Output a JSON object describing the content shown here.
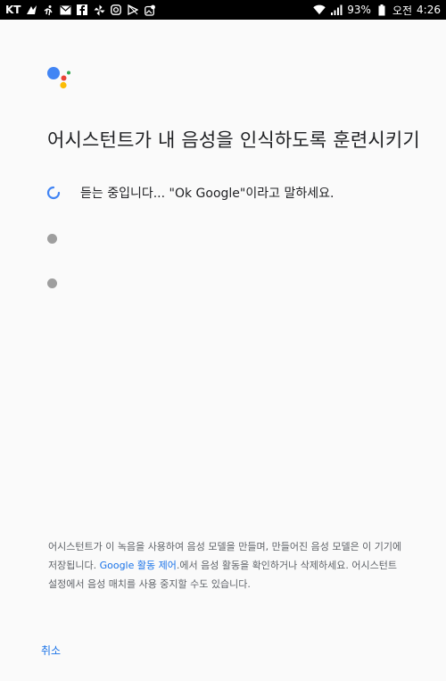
{
  "status_bar": {
    "carrier": "KT",
    "battery_percent": "93%",
    "time_period": "오전",
    "time": "4:26",
    "left_icons": [
      "vpn-key-icon",
      "activity-icon",
      "mail-icon",
      "facebook-icon",
      "pinwheel-icon",
      "instagram-icon",
      "play-icon",
      "gallery-icon"
    ],
    "right_icons": [
      "wifi-icon",
      "signal-icon",
      "battery-icon"
    ]
  },
  "assistant": {
    "logo_colors": {
      "blue": "#4285F4",
      "red": "#EA4335",
      "yellow": "#FBBC05",
      "green": "#34A853"
    }
  },
  "title": "어시스턴트가 내 음성을 인식하도록 훈련시키기",
  "steps": [
    {
      "state": "in-progress",
      "text": "듣는 중입니다... \"Ok Google\"이라고 말하세요."
    },
    {
      "state": "pending",
      "text": ""
    },
    {
      "state": "pending",
      "text": ""
    }
  ],
  "footer": {
    "part1": "어시스턴트가 이 녹음을 사용하여 음성 모델을 만들며, 만들어진 음성 모델은 이 기기에 저장됩니다. ",
    "link": "Google 활동 제어",
    "part2": ".에서 음성 활동을 확인하거나 삭제하세요. 어시스턴트 설정에서 음성 매치를 사용 중지할 수도 있습니다."
  },
  "cancel_label": "취소",
  "colors": {
    "accent": "#1a73e8",
    "spinner": "#4285F4",
    "pending_dot": "#9e9e9e"
  }
}
